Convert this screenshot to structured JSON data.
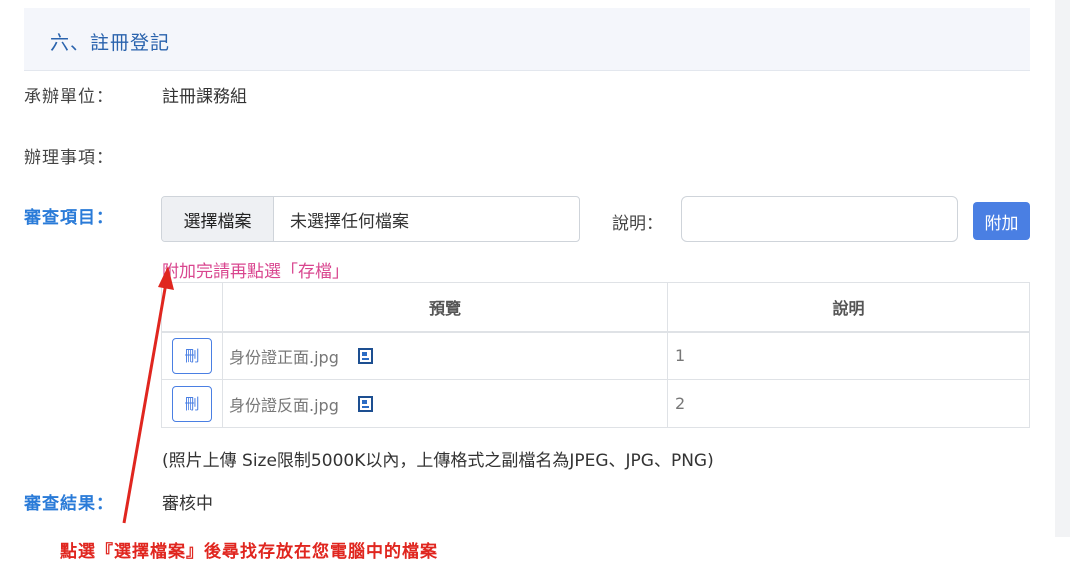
{
  "section": {
    "title": "六、註冊登記"
  },
  "fields": {
    "unit_label": "承辦單位：",
    "unit_value": "註冊課務組",
    "matter_label": "辦理事項：",
    "review_label": "審查項目：",
    "result_label": "審查結果：",
    "result_value": "審核中"
  },
  "upload": {
    "choose_button": "選擇檔案",
    "status_text": "未選擇任何檔案",
    "desc_label": "說明：",
    "desc_value": "",
    "attach_button": "附加",
    "hint": "附加完請再點選「存檔」"
  },
  "table": {
    "headers": [
      "",
      "預覽",
      "說明"
    ],
    "rows": [
      {
        "delete_label": "刪",
        "file_name": "身份證正面.jpg",
        "description": "1"
      },
      {
        "delete_label": "刪",
        "file_name": "身份證反面.jpg",
        "description": "2"
      }
    ]
  },
  "note": "(照片上傳 Size限制5000K以內，上傳格式之副檔名為JPEG、JPG、PNG)",
  "annotation": {
    "caption": "點選『選擇檔案』後尋找存放在您電腦中的檔案",
    "color": "#e0261f"
  },
  "colors": {
    "accent": "#4a7fe3",
    "title": "#2a63ad",
    "hint": "#d9468f"
  }
}
